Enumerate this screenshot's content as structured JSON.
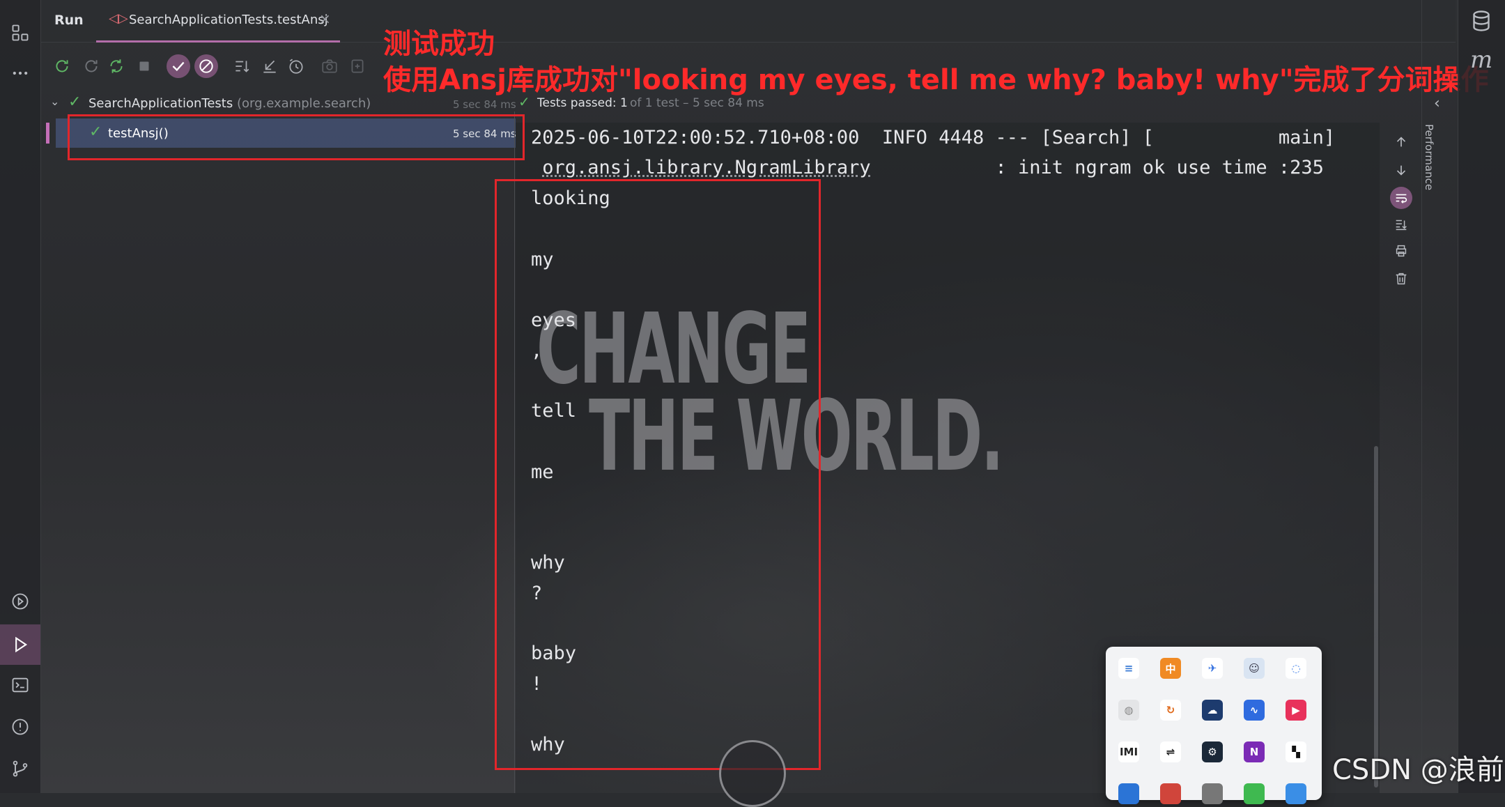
{
  "tabbar": {
    "run_label": "Run",
    "tab_title": "SearchApplicationTests.testAnsj",
    "close": "×"
  },
  "annotation": {
    "line1": "测试成功",
    "line2": "使用Ansj库成功对\"looking my eyes, tell me why? baby! why\"完成了分词操作"
  },
  "tree": {
    "root_name": "SearchApplicationTests",
    "root_package": "(org.example.search)",
    "root_time": "5 sec 84 ms",
    "child_name": "testAnsj()",
    "child_time": "5 sec 84 ms"
  },
  "status": {
    "passed": "Tests passed: 1",
    "detail": "of 1 test – 5 sec 84 ms"
  },
  "console": {
    "log_line1": "2025-06-10T22:00:52.710+08:00  INFO 4448 --- [Search] [           main]",
    "log_line2_class": "org.ansj.library.NgramLibrary",
    "log_line2_msg": "           : init ngram ok use time :235",
    "tokens": [
      "looking",
      "my",
      "eyes",
      ",",
      "tell",
      "me",
      "why",
      "?",
      "baby",
      "!",
      "why"
    ]
  },
  "slogan": {
    "line1": "CHANGE",
    "line2": "THE WORLD."
  },
  "sidebar_right": {
    "performance": "Performance",
    "m_icon": "m"
  },
  "watermark": "CSDN @浪前",
  "colors": {
    "accent": "#b46eaa",
    "pass_green": "#5fb865",
    "annotation_red": "#e2262b",
    "selection": "#50649680"
  }
}
